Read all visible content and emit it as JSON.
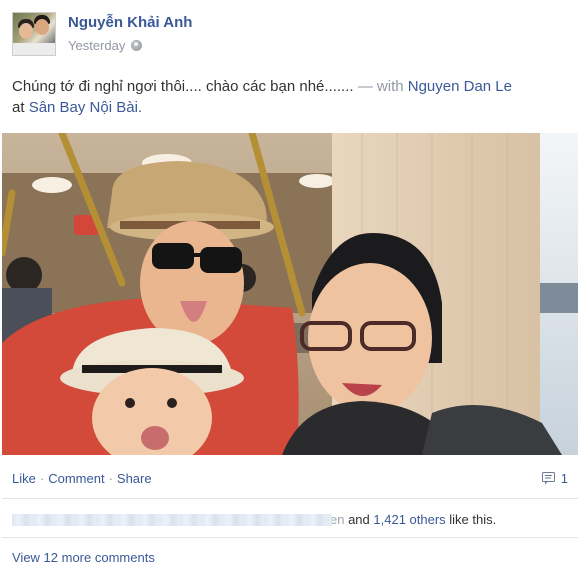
{
  "post": {
    "author": "Nguyễn Khải Anh",
    "timestamp": "Yesterday",
    "privacy_icon": "globe-icon",
    "message": "Chúng tớ đi nghỉ ngơi thôi.... chào các bạn nhé.......",
    "with_prefix": "— with",
    "tagged_person": "Nguyen Dan Le",
    "at_prefix": "at",
    "location": "Sân Bay Nội Bài.",
    "photo_description_icon": "photo"
  },
  "actions": {
    "like": "Like",
    "comment": "Comment",
    "share": "Share",
    "separator": "·",
    "comment_count": "1",
    "comment_count_icon": "comment-icon"
  },
  "likes": {
    "blurred_tail": "en",
    "and_text": " and ",
    "others": "1,421 others",
    "like_suffix": " like this."
  },
  "comments": {
    "view_more": "View 12 more comments"
  },
  "colors": {
    "link": "#3b5998",
    "muted": "#9197a3"
  }
}
